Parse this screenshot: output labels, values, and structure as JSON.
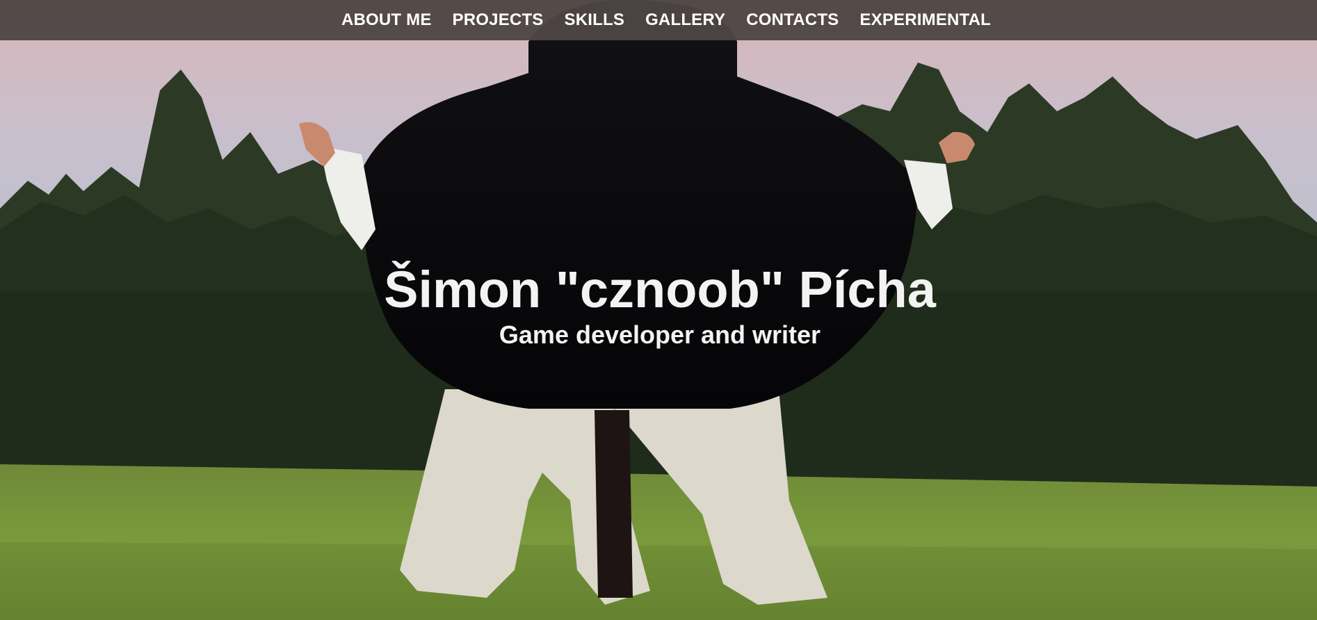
{
  "nav": {
    "items": [
      {
        "label": "ABOUT ME"
      },
      {
        "label": "PROJECTS"
      },
      {
        "label": "SKILLS"
      },
      {
        "label": "GALLERY"
      },
      {
        "label": "CONTACTS"
      },
      {
        "label": "EXPERIMENTAL"
      }
    ]
  },
  "hero": {
    "title": "Šimon \"cznoob\" Pícha",
    "subtitle": "Game developer and writer"
  },
  "colors": {
    "navbar_background": "#4e4644",
    "nav_text": "#ffffff",
    "hero_text": "#f3f3f3"
  }
}
